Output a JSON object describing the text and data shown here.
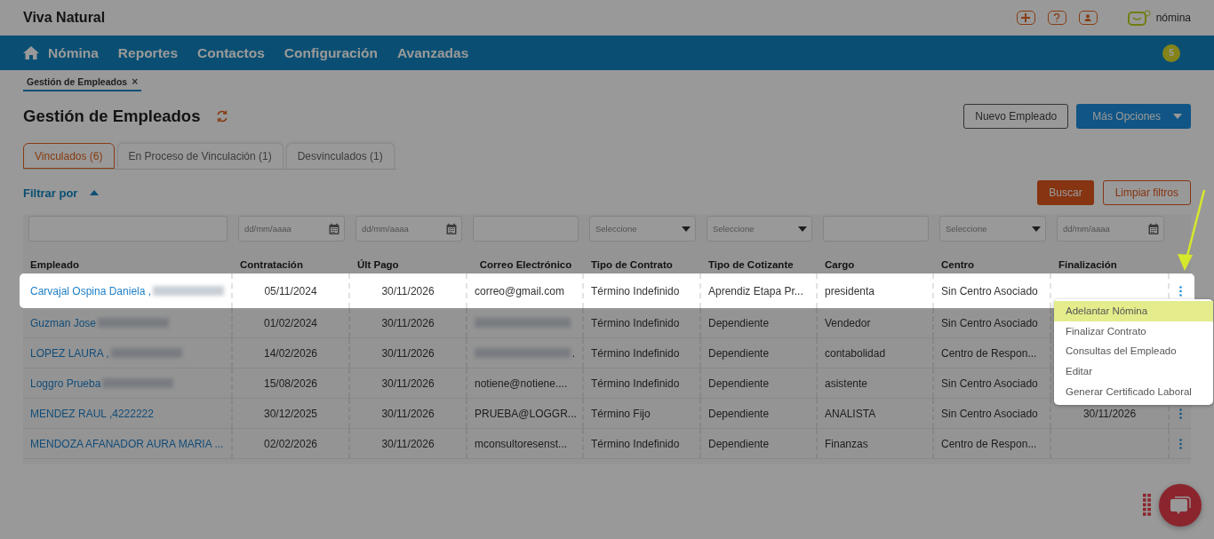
{
  "app": {
    "title": "Viva Natural",
    "logo_text": "nómina",
    "badge": "5"
  },
  "nav": [
    {
      "label": "Nómina",
      "kind": "home"
    },
    {
      "label": "Reportes",
      "kind": "plain"
    },
    {
      "label": "Contactos",
      "kind": "plain"
    },
    {
      "label": "Configuración",
      "kind": "plain"
    },
    {
      "label": "Avanzadas",
      "kind": "plain"
    }
  ],
  "breadcrumb": {
    "label": "Gestión de Empleados",
    "close": "×"
  },
  "page_title": "Gestión de Empleados",
  "actions": [
    {
      "label": "Nuevo Empleado",
      "kind": "outline"
    },
    {
      "label": "Más Opciones",
      "kind": "dropdown"
    }
  ],
  "tabs": [
    {
      "label": "Vinculados (6)",
      "selected": true
    },
    {
      "label": "En Proceso de Vinculación (1)",
      "selected": false
    },
    {
      "label": "Desvinculados (1)",
      "selected": false
    }
  ],
  "filter": {
    "label": "Filtrar por",
    "expanded": true,
    "buttons": [
      {
        "label": "Buscar",
        "kind": "primary"
      },
      {
        "label": "Limpiar filtros",
        "kind": "outline"
      }
    ]
  },
  "filters": [
    {
      "kind": "text"
    },
    {
      "kind": "date",
      "placeholder": "dd/mm/aaaa"
    },
    {
      "kind": "date",
      "placeholder": "dd/mm/aaaa"
    },
    {
      "kind": "text"
    },
    {
      "kind": "select",
      "placeholder": "Seleccione"
    },
    {
      "kind": "select",
      "placeholder": "Seleccione"
    },
    {
      "kind": "text"
    },
    {
      "kind": "select",
      "placeholder": "Seleccione"
    },
    {
      "kind": "date",
      "placeholder": "dd/mm/aaaa"
    }
  ],
  "columns": [
    "Empleado",
    "Contratación",
    "Últ Pago",
    "Correo Electrónico",
    "Tipo de Contrato",
    "Tipo de Cotizante",
    "Cargo",
    "Centro",
    "Finalización"
  ],
  "rows": [
    {
      "highlighted": true,
      "empleado": "Carvajal Ospina Daniela ,",
      "name_redacted": true,
      "contratacion": "05/11/2024",
      "ult_pago": "30/11/2026",
      "correo": "correo@gmail.com",
      "tipo_contrato": "Término Indefinido",
      "tipo_cotizante": "Aprendiz Etapa Pr...",
      "cargo": "presidenta",
      "centro": "Sin Centro Asociado"
    },
    {
      "highlighted": false,
      "empleado": "Guzman Jose",
      "name_redacted": true,
      "contratacion": "01/02/2024",
      "ult_pago": "30/11/2026",
      "email_redacted": true,
      "tipo_contrato": "Término Indefinido",
      "tipo_cotizante": "Dependiente",
      "cargo": "Vendedor",
      "centro": "Sin Centro Asociado"
    },
    {
      "highlighted": false,
      "empleado": "LOPEZ LAURA ,",
      "name_redacted": true,
      "contratacion": "14/02/2026",
      "ult_pago": "30/11/2026",
      "correo": ".",
      "email_redacted": true,
      "tipo_contrato": "Término Indefinido",
      "tipo_cotizante": "Dependiente",
      "cargo": "contabolidad",
      "centro": "Centro de Respon..."
    },
    {
      "highlighted": false,
      "empleado": "Loggro Prueba",
      "name_redacted": true,
      "contratacion": "15/08/2026",
      "ult_pago": "30/11/2026",
      "correo": "notiene@notiene....",
      "tipo_contrato": "Término Indefinido",
      "tipo_cotizante": "Dependiente",
      "cargo": "asistente",
      "centro": "Sin Centro Asociado"
    },
    {
      "highlighted": false,
      "empleado": "MENDEZ RAUL ,4222222",
      "contratacion": "30/12/2025",
      "ult_pago": "30/11/2026",
      "correo": "PRUEBA@LOGGR...",
      "tipo_contrato": "Término Fijo",
      "tipo_cotizante": "Dependiente",
      "cargo": "ANALISTA",
      "centro": "Sin Centro Asociado",
      "finalizacion": "30/11/2026"
    },
    {
      "highlighted": false,
      "empleado": "MENDOZA AFANADOR AURA MARIA ...",
      "contratacion": "02/02/2026",
      "ult_pago": "30/11/2026",
      "correo": "mconsultoresenst...",
      "tipo_contrato": "Término Indefinido",
      "tipo_cotizante": "Dependiente",
      "cargo": "Finanzas",
      "centro": "Centro de Respon..."
    }
  ],
  "row_menu": [
    {
      "label": "Adelantar Nómina",
      "selected": true
    },
    {
      "label": "Finalizar Contrato",
      "selected": false
    },
    {
      "label": "Consultas del Empleado",
      "selected": false
    },
    {
      "label": "Editar",
      "selected": false
    },
    {
      "label": "Generar Certificado Laboral",
      "selected": false
    }
  ]
}
